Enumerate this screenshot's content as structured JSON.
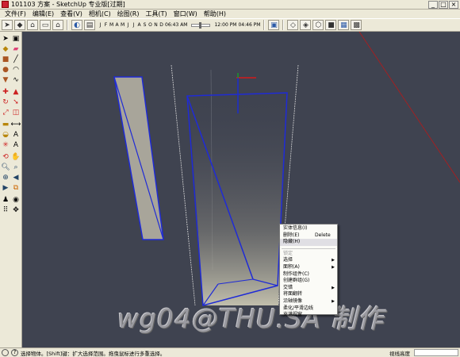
{
  "window": {
    "title": "101103 方案 - SketchUp 专业版[过期]"
  },
  "menubar": {
    "items": [
      "文件(F)",
      "编辑(E)",
      "查看(V)",
      "相机(C)",
      "绘图(R)",
      "工具(T)",
      "窗口(W)",
      "帮助(H)"
    ]
  },
  "toolbar": {
    "months": [
      "J",
      "F",
      "M",
      "A",
      "M",
      "J",
      "J",
      "A",
      "S",
      "O",
      "N",
      "D"
    ],
    "time_start": "06:43 AM",
    "time_noon": "12:00 PM",
    "time_end": "04:46 PM",
    "icons": [
      "paint-bucket-icon",
      "home-view-icon",
      "iso-view-icon",
      "top-view-icon",
      "front-view-icon",
      "right-view-icon",
      "back-view-icon",
      "shadow-settings-icon",
      "xray-style-icon",
      "wireframe-style-icon",
      "hidden-line-style-icon",
      "shaded-style-icon",
      "textured-style-icon",
      "monochrome-style-icon"
    ]
  },
  "context_menu": {
    "items": [
      {
        "label": "实体信息(I)",
        "shortcut": "",
        "submenu": false,
        "disabled": false,
        "highlighted": false
      },
      {
        "label": "删除(E)",
        "shortcut": "Delete",
        "submenu": false,
        "disabled": false,
        "highlighted": false
      },
      {
        "label": "隐藏(H)",
        "shortcut": "",
        "submenu": false,
        "disabled": false,
        "highlighted": true
      },
      {
        "separator": true
      },
      {
        "label": "锁定",
        "shortcut": "",
        "submenu": false,
        "disabled": true,
        "highlighted": false
      },
      {
        "label": "选择",
        "shortcut": "",
        "submenu": true,
        "disabled": false,
        "highlighted": false
      },
      {
        "label": "面积(A)",
        "shortcut": "",
        "submenu": true,
        "disabled": false,
        "highlighted": false
      },
      {
        "label": "制作组件(C)",
        "shortcut": "",
        "submenu": false,
        "disabled": false,
        "highlighted": false
      },
      {
        "label": "创建群组(G)",
        "shortcut": "",
        "submenu": false,
        "disabled": false,
        "highlighted": false
      },
      {
        "label": "交错",
        "shortcut": "",
        "submenu": true,
        "disabled": false,
        "highlighted": false
      },
      {
        "label": "将面翻转",
        "shortcut": "",
        "submenu": false,
        "disabled": false,
        "highlighted": false
      },
      {
        "label": "沿轴镜像",
        "shortcut": "",
        "submenu": true,
        "disabled": false,
        "highlighted": false
      },
      {
        "label": "柔化/平滑边线",
        "shortcut": "",
        "submenu": false,
        "disabled": false,
        "highlighted": false
      },
      {
        "label": "充满视窗",
        "shortcut": "",
        "submenu": false,
        "disabled": false,
        "highlighted": false
      }
    ]
  },
  "watermark": "wg04@THU.SA 制作",
  "statusbar": {
    "message": "选择物体。[Shift]键：扩大选择范围。拖曳鼠标进行多重选择。",
    "vcb_label": "视线高度",
    "vcb_value": ""
  },
  "colors": {
    "viewport_bg": "#3f4350",
    "selection_blue": "#1f2bd6",
    "axis_red": "#d41a1a",
    "axis_blue": "#1a2cd6",
    "face_fill": "#a8a59a"
  }
}
